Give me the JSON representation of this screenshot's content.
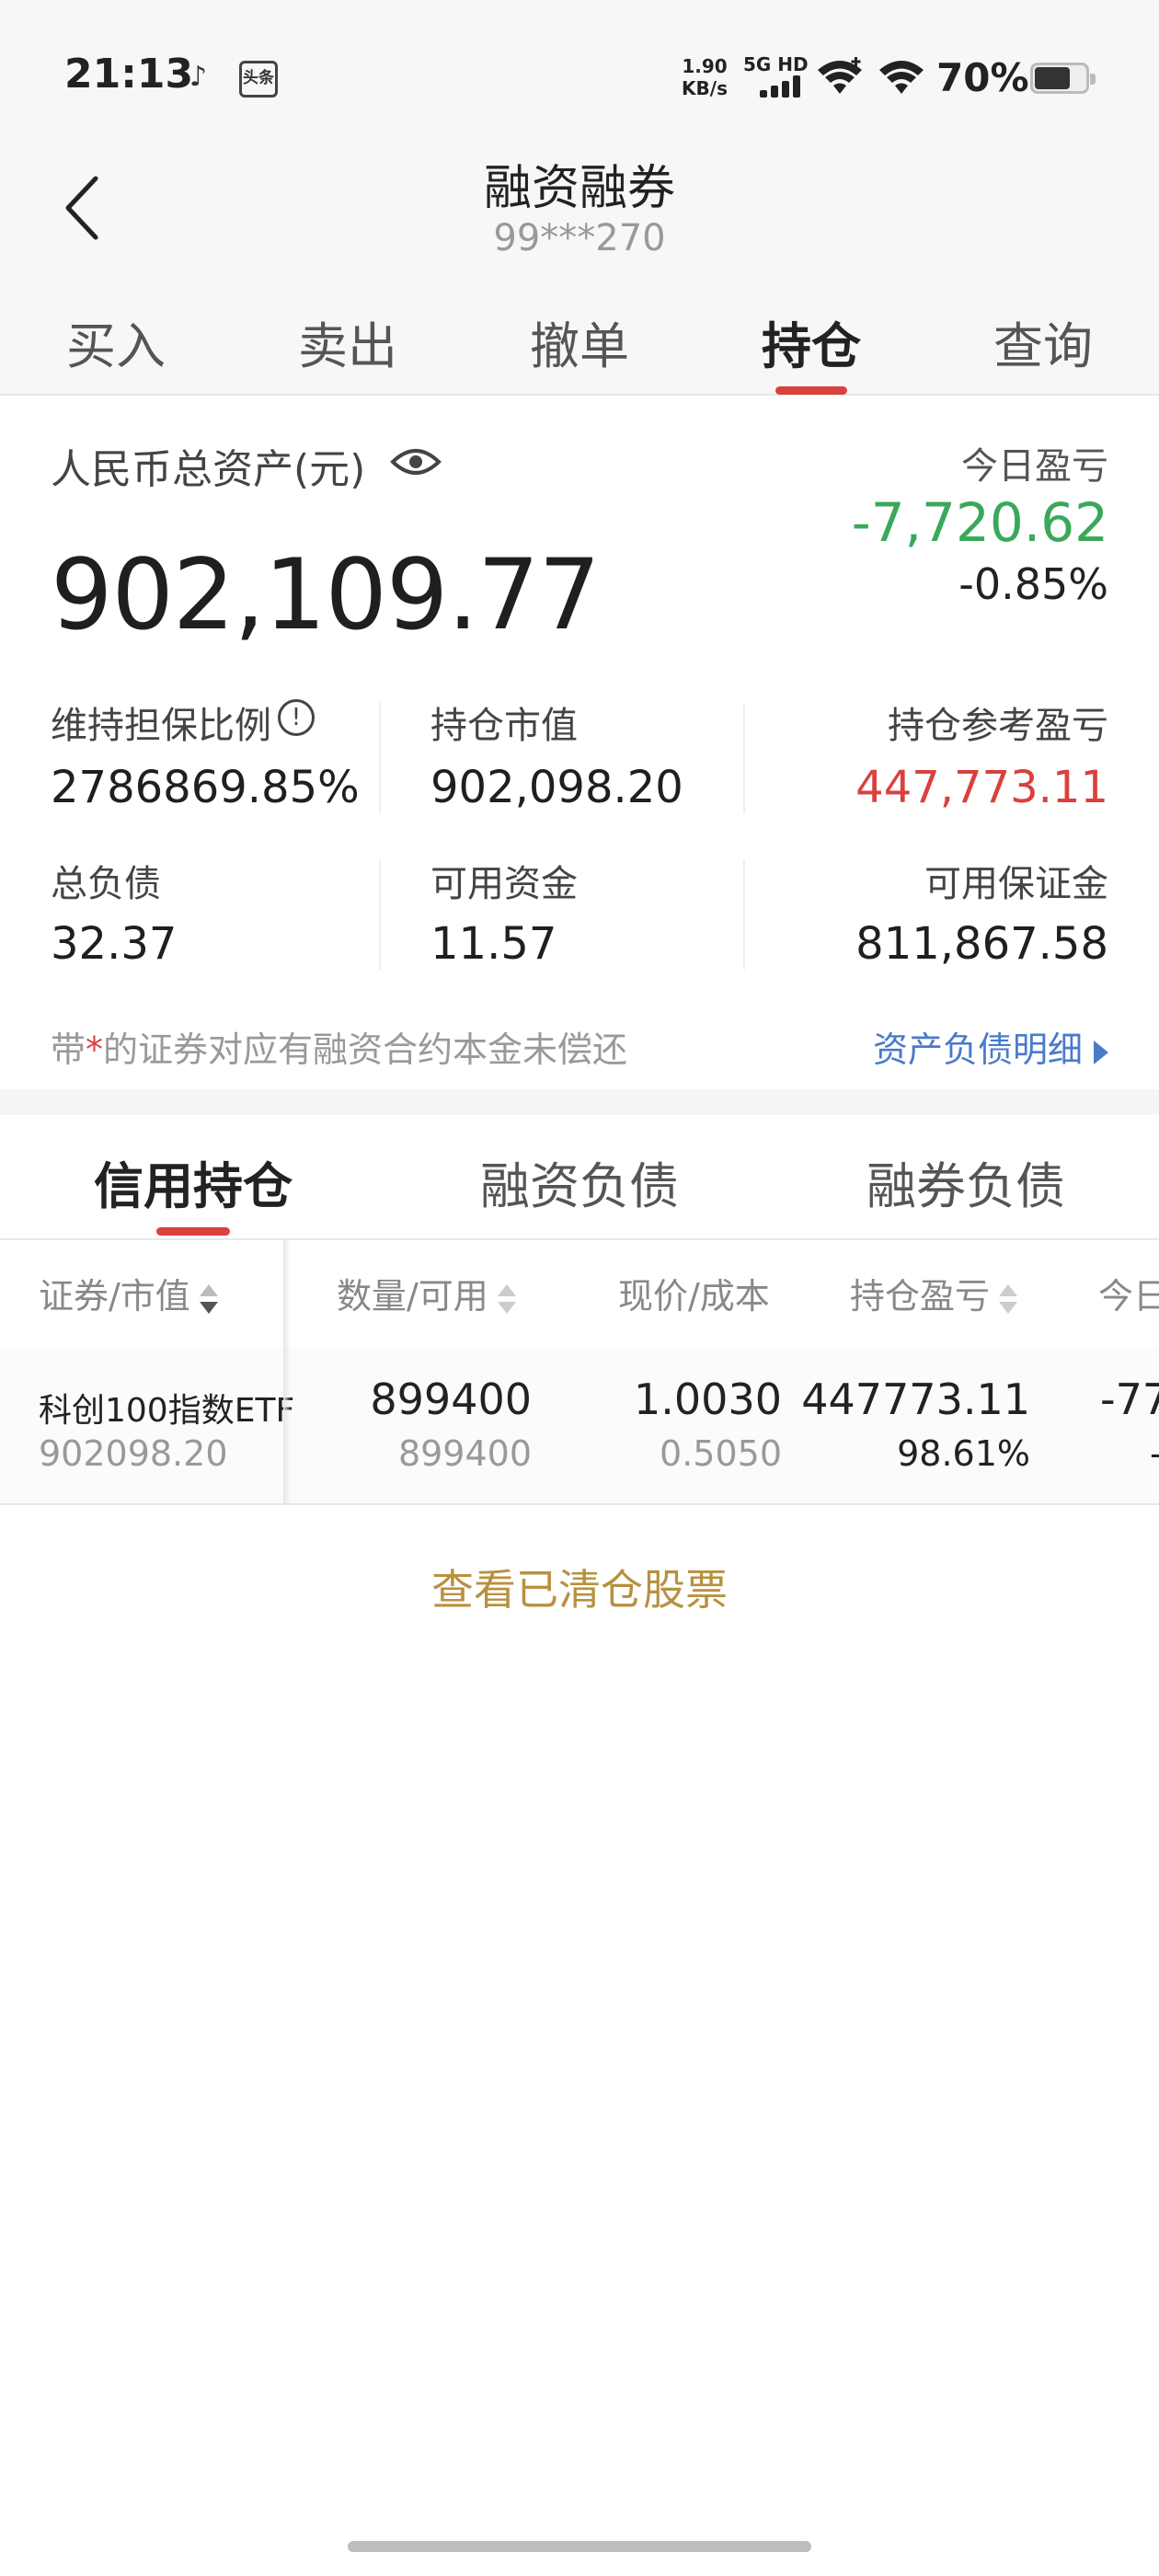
{
  "status_bar": {
    "time": "21:13",
    "net_speed_value": "1.90",
    "net_speed_unit": "KB/s",
    "network_type": "5G HD",
    "battery_percent": "70%",
    "battery_level": 0.7,
    "notification_icons": [
      "music-note-icon",
      "toutiao-app-icon"
    ],
    "toutiao_label": "头条"
  },
  "header": {
    "title": "融资融券",
    "account": "99***270"
  },
  "trade_tabs": {
    "items": [
      "买入",
      "卖出",
      "撤单",
      "持仓",
      "查询"
    ],
    "active_index": 3
  },
  "summary": {
    "total_assets_label": "人民币总资产(元)",
    "total_assets_value": "902,109.77",
    "today_pl_label": "今日盈亏",
    "today_pl_value": "-7,720.62",
    "today_pl_pct": "-0.85%",
    "maintenance_ratio_label": "维持担保比例",
    "maintenance_ratio_value": "2786869.85%",
    "market_value_label": "持仓市值",
    "market_value_value": "902,098.20",
    "position_pl_label": "持仓参考盈亏",
    "position_pl_value": "447,773.11",
    "total_debt_label": "总负债",
    "total_debt_value": "32.37",
    "available_cash_label": "可用资金",
    "available_cash_value": "11.57",
    "available_margin_label": "可用保证金",
    "available_margin_value": "811,867.58",
    "note_prefix": "带",
    "note_star": "*",
    "note_suffix": "的证券对应有融资合约本金未偿还",
    "detail_link": "资产负债明细"
  },
  "sub_tabs": {
    "items": [
      "信用持仓",
      "融资负债",
      "融券负债"
    ],
    "active_index": 0
  },
  "table": {
    "headers": [
      "证券/市值",
      "数量/可用",
      "现价/成本",
      "持仓盈亏",
      "今日"
    ],
    "rows": [
      {
        "name": "科创100指数ETF",
        "market_value": "902098.20",
        "quantity": "899400",
        "available": "899400",
        "price": "1.0030",
        "cost": "0.5050",
        "pl": "447773.11",
        "pl_pct": "98.61%",
        "today_partial": "-77",
        "today_partial_sub": "-"
      }
    ]
  },
  "cleared_link": "查看已清仓股票",
  "colors": {
    "accent_red": "#d9413d",
    "gain_green": "#3aa85a",
    "link_blue": "#4a7ac9",
    "link_gold": "#b8913f"
  }
}
